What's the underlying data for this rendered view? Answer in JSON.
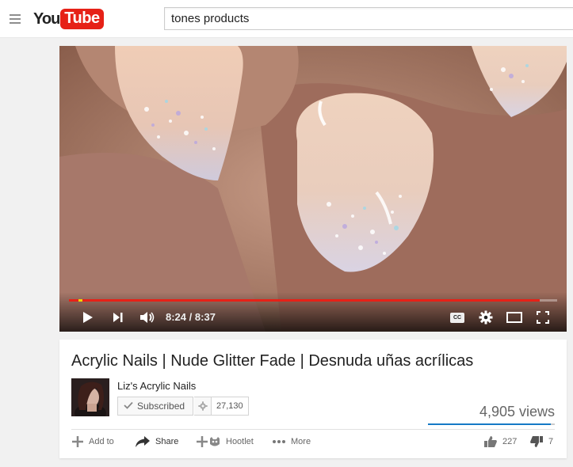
{
  "header": {
    "logo_you": "You",
    "logo_tube": "Tube",
    "search_value": "tones products"
  },
  "player": {
    "time_current": "8:24",
    "time_separator": "/",
    "time_total": "8:37",
    "progress_fraction": 0.964,
    "icons": [
      "play-icon",
      "next-icon",
      "volume-icon",
      "captions-icon",
      "settings-gear-icon",
      "theater-mode-icon",
      "fullscreen-icon"
    ],
    "captions_label": "CC"
  },
  "video": {
    "title": "Acrylic Nails | Nude Glitter Fade | Desnuda uñas acrílicas",
    "channel_name": "Liz's Acrylic Nails",
    "subscribe_label": "Subscribed",
    "subscriber_count": "27,130",
    "views": "4,905 views",
    "like_count": "227",
    "dislike_count": "7",
    "likes_fraction": 0.97
  },
  "actions": {
    "add_to": "Add to",
    "share": "Share",
    "hootlet": "Hootlet",
    "more": "More"
  },
  "colors": {
    "brand_red": "#e62117",
    "progress_red": "#e62117",
    "like_bar_blue": "#167ac6"
  }
}
